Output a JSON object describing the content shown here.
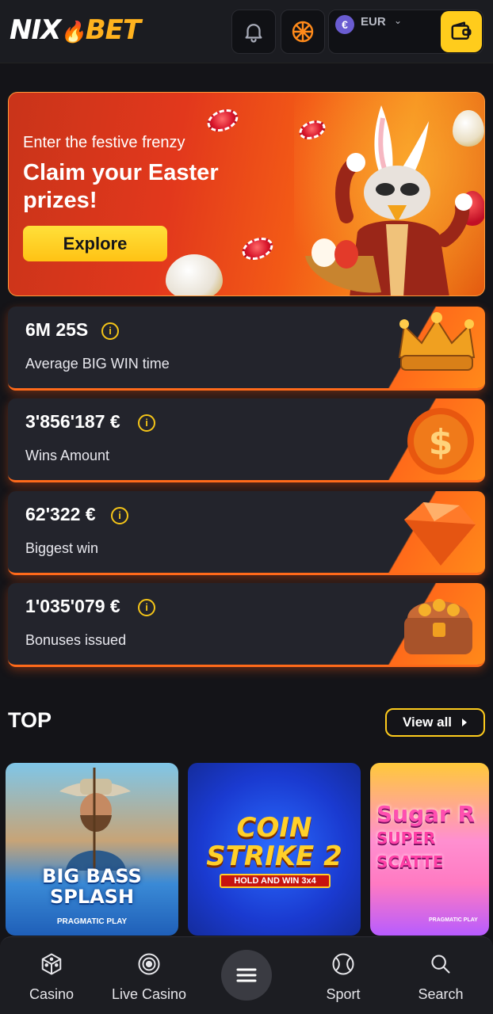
{
  "header": {
    "logo_part1": "NIX",
    "logo_part2": "BET",
    "currency_label": "EUR",
    "currency_symbol": "€",
    "bell_icon": "bell-icon",
    "wheel_icon": "fortune-wheel-icon",
    "wallet_icon": "wallet-icon"
  },
  "banner": {
    "subtitle": "Enter the festive frenzy",
    "title": "Claim your Easter prizes!",
    "button_label": "Explore"
  },
  "stats": [
    {
      "value": "6M 25S",
      "label": "Average BIG WIN time",
      "image": "crown"
    },
    {
      "value": "3'856'187 €",
      "label": "Wins Amount",
      "image": "dollar-coin"
    },
    {
      "value": "62'322 €",
      "label": "Biggest win",
      "image": "gem"
    },
    {
      "value": "1'035'079 €",
      "label": "Bonuses issued",
      "image": "treasure-chest"
    }
  ],
  "info_glyph": "i",
  "top": {
    "title": "TOP",
    "view_all_label": "View all",
    "games": [
      {
        "title_line1": "BIG BASS",
        "title_line2": "SPLASH",
        "provider": "PRAGMATIC PLAY"
      },
      {
        "title_line1": "COIN",
        "title_line2": "STRIKE 2",
        "subtitle": "HOLD AND WIN 3x4"
      },
      {
        "title_line1": "Sugar R",
        "title_line2": "SUPER SCATTE",
        "provider": "PRAGMATIC PLAY"
      }
    ]
  },
  "bottom_nav": {
    "items": [
      {
        "label": "Casino",
        "icon": "dice-icon"
      },
      {
        "label": "Live Casino",
        "icon": "roulette-chip-icon"
      },
      {
        "label": "Sport",
        "icon": "tennis-ball-icon"
      },
      {
        "label": "Search",
        "icon": "search-icon"
      }
    ],
    "menu_icon": "menu-icon"
  },
  "colors": {
    "accent_yellow": "#ffcc1c",
    "accent_orange": "#ff6a1a",
    "background": "#141418",
    "card": "#23242c"
  }
}
